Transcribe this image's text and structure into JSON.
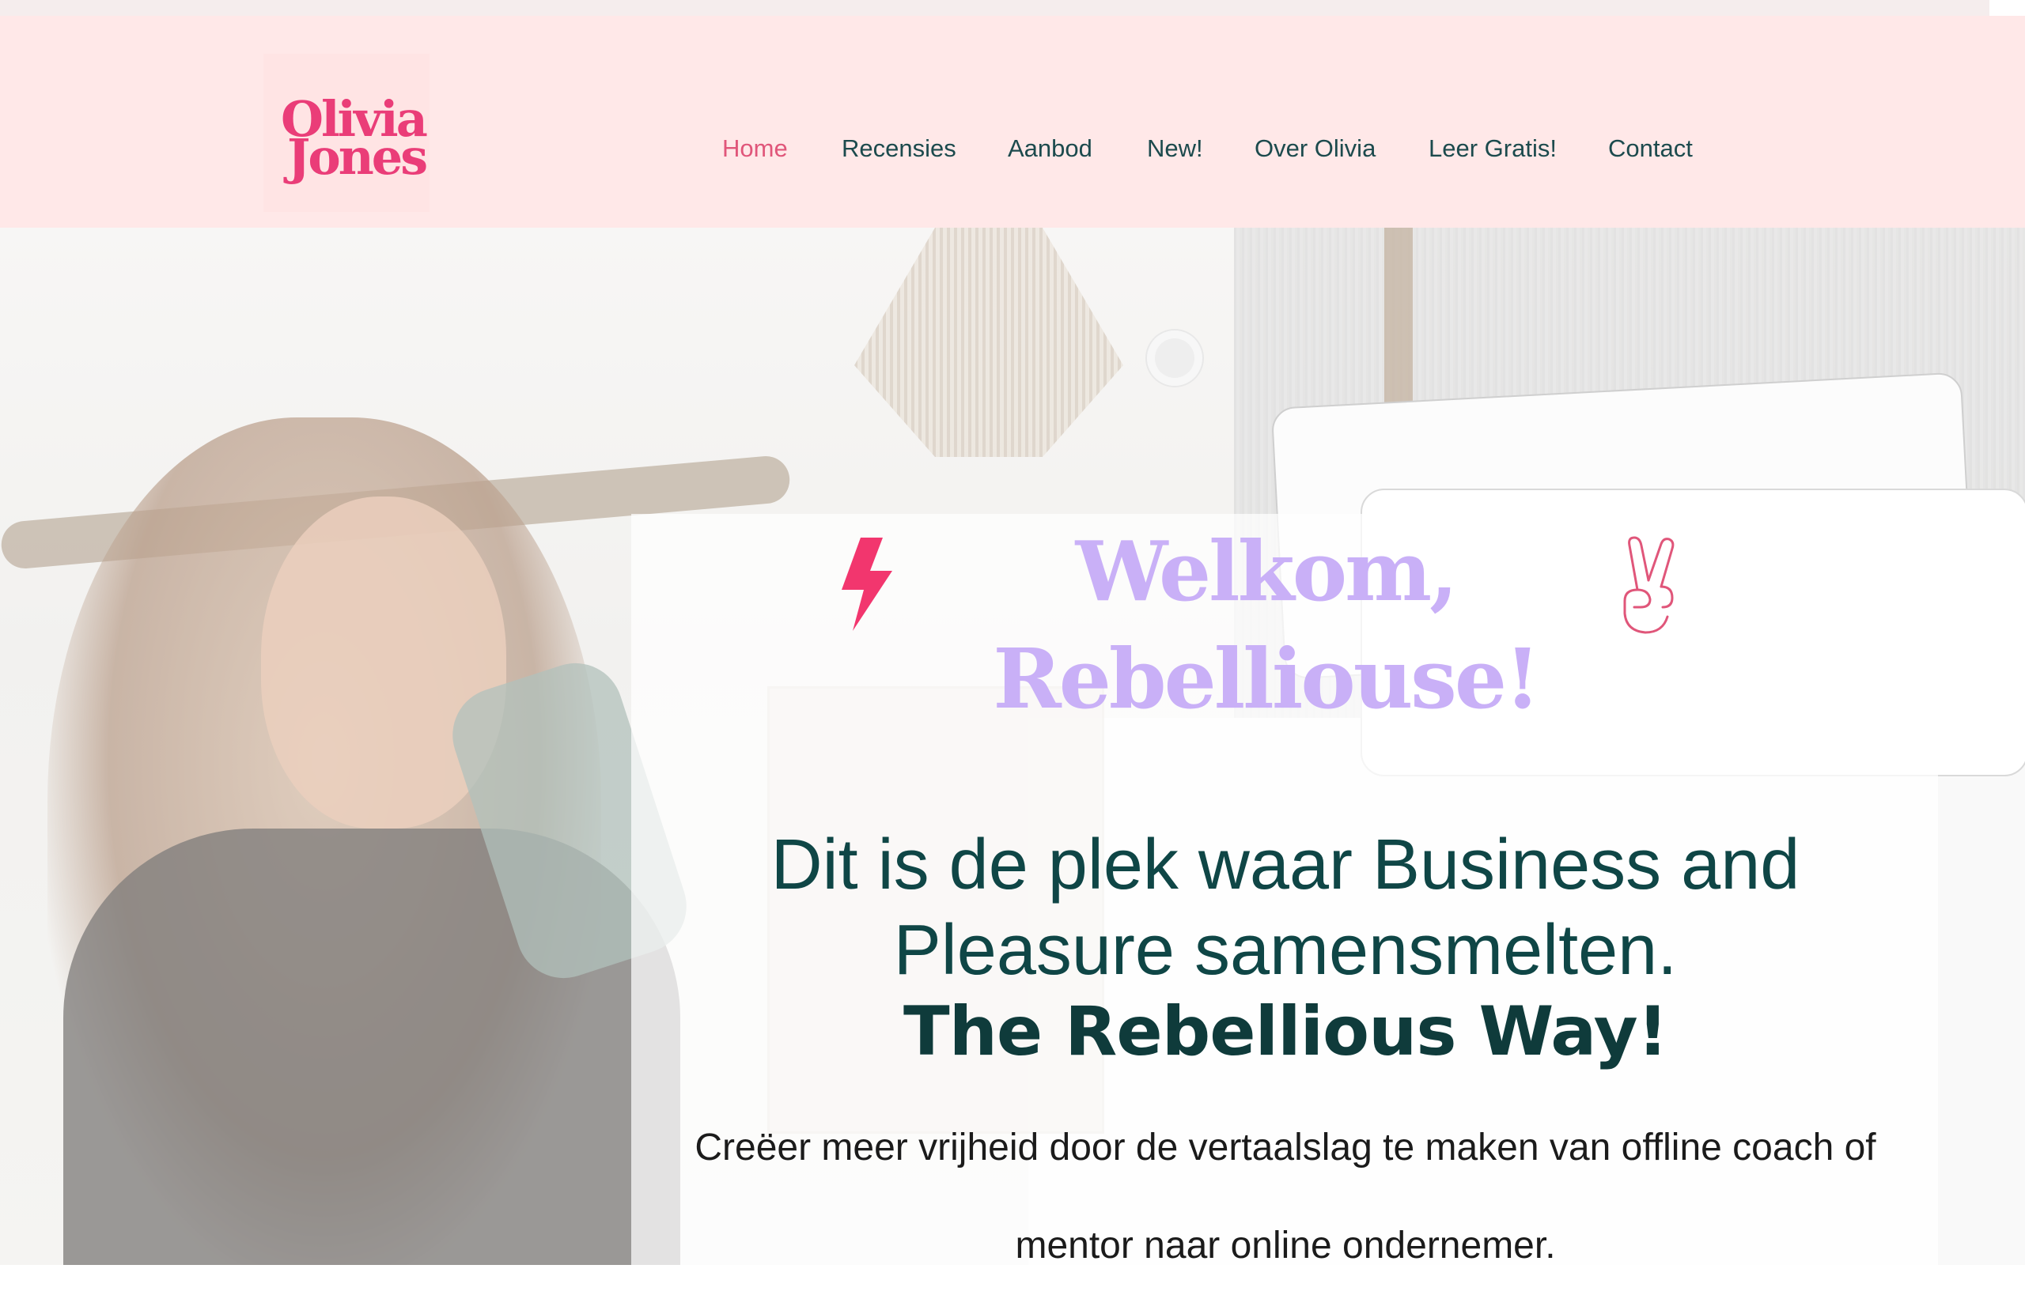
{
  "header": {
    "logo": {
      "line1": "Olivia",
      "line2": "Jones"
    },
    "nav": [
      {
        "label": "Home",
        "active": true
      },
      {
        "label": "Recensies",
        "active": false
      },
      {
        "label": "Aanbod",
        "active": false
      },
      {
        "label": "New!",
        "active": false
      },
      {
        "label": "Over Olivia",
        "active": false
      },
      {
        "label": "Leer Gratis!",
        "active": false
      },
      {
        "label": "Contact",
        "active": false
      }
    ]
  },
  "hero": {
    "title_line1": "Welkom,",
    "title_line2": "Rebelliouse!",
    "intro": "Dit is de plek waar Business and Pleasure samensmelten.",
    "tagline": "The Rebellious Way!",
    "description": "Creëer meer vrijheid door de vertaalslag te maken van offline coach of mentor naar online ondernemer.",
    "icons": [
      "lightning-bolt-icon",
      "peace-hand-icon"
    ]
  },
  "colors": {
    "header_bg": "#ffe8e8",
    "logo": "#ea3d78",
    "nav_text": "#1c4a4d",
    "nav_active": "#e0567a",
    "title": "#c9b0f7",
    "intro": "#0f4646",
    "bolt": "#f2366e"
  }
}
